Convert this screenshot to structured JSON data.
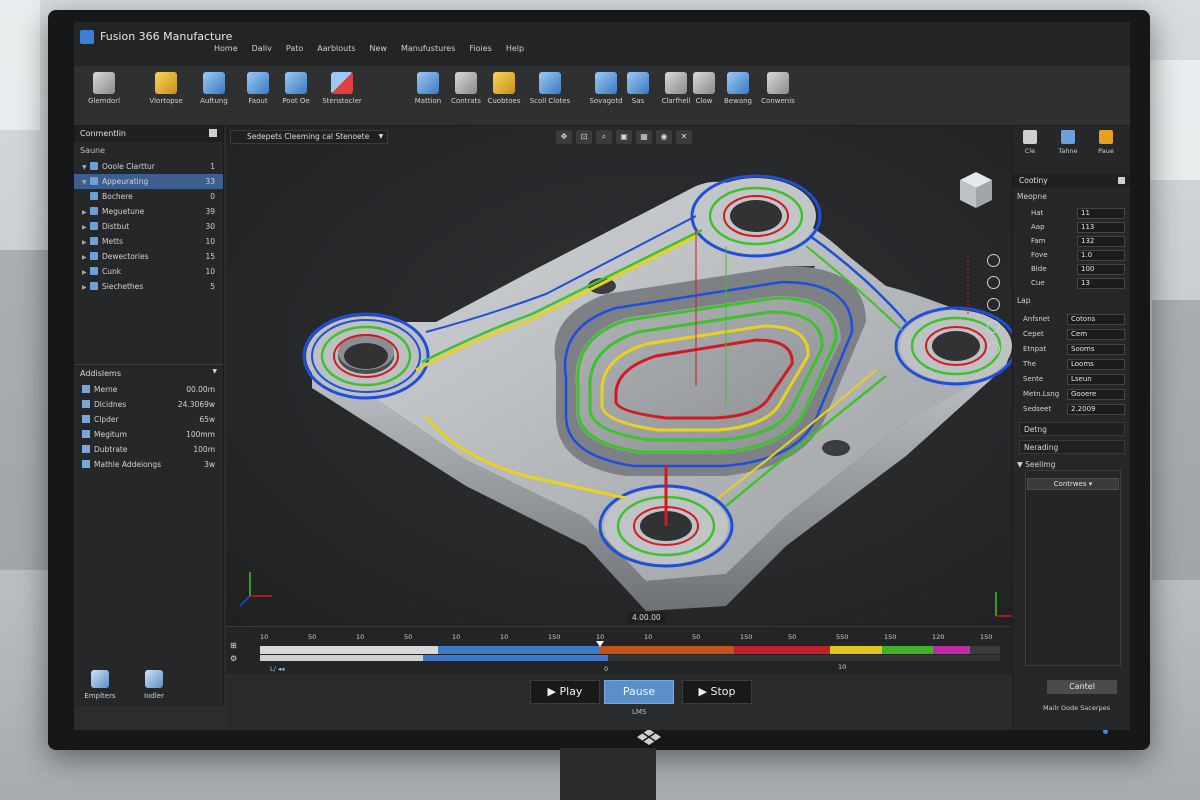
{
  "app": {
    "title": "Fusion 366 Manufacture",
    "menu": [
      "Home",
      "Daliv",
      "Pato",
      "Aarblouts",
      "New",
      "Manufustures",
      "Fioies",
      "Help"
    ]
  },
  "ribbon": {
    "buttons": [
      {
        "label": "Glemdorl",
        "icon": "document-icon"
      },
      {
        "label": "Vlortopse",
        "icon": "setup-icon"
      },
      {
        "label": "Auftung",
        "icon": "new-setup-icon"
      },
      {
        "label": "Faout",
        "icon": "face-icon"
      },
      {
        "label": "Poot Oe",
        "icon": "pocket-icon"
      },
      {
        "label": "Stenstocler",
        "icon": "stock-icon"
      },
      {
        "label": "Mattion",
        "icon": "motion-icon"
      },
      {
        "label": "Contrats",
        "icon": "contour-icon"
      },
      {
        "label": "Cuobtoes",
        "icon": "cut-icon"
      },
      {
        "label": "Scoll Clotes",
        "icon": "scallop-icon"
      },
      {
        "label": "Sovagotd",
        "icon": "save-icon"
      },
      {
        "label": "Sas",
        "icon": "simulate-icon"
      },
      {
        "label": "Clarfhell",
        "icon": "chamfer-icon"
      },
      {
        "label": "Clow",
        "icon": "clow-icon"
      },
      {
        "label": "Bewang",
        "icon": "boring-icon"
      },
      {
        "label": "Conwenis",
        "icon": "components-icon"
      }
    ]
  },
  "browser": {
    "header": "Conmentlin",
    "subheader": "Saune",
    "items": [
      {
        "label": "Ooole Clarttur",
        "count": "1"
      },
      {
        "label": "Appeurating",
        "count": "33"
      },
      {
        "label": "Bochere",
        "count": "0"
      },
      {
        "label": "Meguetune",
        "count": "39"
      },
      {
        "label": "Distbut",
        "count": "30"
      },
      {
        "label": "Metts",
        "count": "10"
      },
      {
        "label": "Dewectories",
        "count": "15"
      },
      {
        "label": "Cunk",
        "count": "10"
      },
      {
        "label": "Siechethes",
        "count": "5"
      }
    ],
    "additions_header": "Addislems",
    "additions": [
      {
        "label": "Merne",
        "value": "00.00m"
      },
      {
        "label": "Dlcidnes",
        "value": "24.3069w"
      },
      {
        "label": "Clpder",
        "value": "65w"
      },
      {
        "label": "Megitum",
        "value": "100mm"
      },
      {
        "label": "Dubtrate",
        "value": "100m"
      },
      {
        "label": "Mathle Addeiongs",
        "value": "3w"
      }
    ],
    "footer": [
      {
        "label": "Emplters",
        "icon": "explorer-icon"
      },
      {
        "label": "Iodler",
        "icon": "folder-icon"
      }
    ]
  },
  "viewport": {
    "setup_selector": "Sedepets Cleeming cal Stenoete",
    "readout": "4.00.00"
  },
  "timeline": {
    "ticks": [
      "10",
      "50",
      "10",
      "50",
      "10",
      "10",
      "150",
      "10",
      "10",
      "50",
      "150",
      "50",
      "550",
      "150",
      "120",
      "150"
    ],
    "under_label": "10",
    "marker_label": "0",
    "progress": 0.46,
    "segments": [
      {
        "color": "#d8d8d8",
        "fraction": 0.24
      },
      {
        "color": "#3e79c9",
        "fraction": 0.22
      },
      {
        "color": "#c4521a",
        "fraction": 0.18
      },
      {
        "color": "#c0202a",
        "fraction": 0.13
      },
      {
        "color": "#e0c420",
        "fraction": 0.07
      },
      {
        "color": "#43b02a",
        "fraction": 0.07
      },
      {
        "color": "#c02aa8",
        "fraction": 0.05
      },
      {
        "color": "#3a3b3d",
        "fraction": 0.04
      }
    ]
  },
  "playback": {
    "play": "Play",
    "pause": "Pause",
    "stop": "Stop",
    "sub": "LMS"
  },
  "right_panel": {
    "tools": [
      {
        "label": "Cle",
        "icon": "pen-icon"
      },
      {
        "label": "Tahne",
        "icon": "tool-icon"
      },
      {
        "label": "Paue",
        "icon": "pause-icon"
      }
    ],
    "header": "Cootiny",
    "section1": "Meopne",
    "rows1": [
      {
        "label": "Hat",
        "value": "11"
      },
      {
        "label": "Aap",
        "value": "113"
      },
      {
        "label": "Fam",
        "value": "132"
      },
      {
        "label": "Fove",
        "value": "1.0"
      },
      {
        "label": "Blde",
        "value": "100"
      },
      {
        "label": "Cue",
        "value": "13"
      }
    ],
    "section2": "Lap",
    "rows2": [
      {
        "label": "Anfsnet",
        "value": "Cotons"
      },
      {
        "label": "Cepet",
        "value": "Cem"
      },
      {
        "label": "Etnpat",
        "value": "Sooms"
      },
      {
        "label": "The",
        "value": "Looms"
      },
      {
        "label": "Sente",
        "value": "Lseun"
      },
      {
        "label": "Metn.Lsng",
        "value": "Gooere"
      },
      {
        "label": "Sedseet",
        "value": "2.2009"
      }
    ],
    "bar1": "Detng",
    "bar2": "Nerading",
    "section3": "Seelimg",
    "dropdown": "Contrwes",
    "cancel": "Cantel",
    "footer": "Mailr Gode Sacerpes"
  },
  "colors": {
    "toolpath_blue": "#1f4fd6",
    "toolpath_green": "#3fc12d",
    "toolpath_yellow": "#e8d21f",
    "toolpath_red": "#d11a22",
    "accent": "#5b8fcc"
  }
}
